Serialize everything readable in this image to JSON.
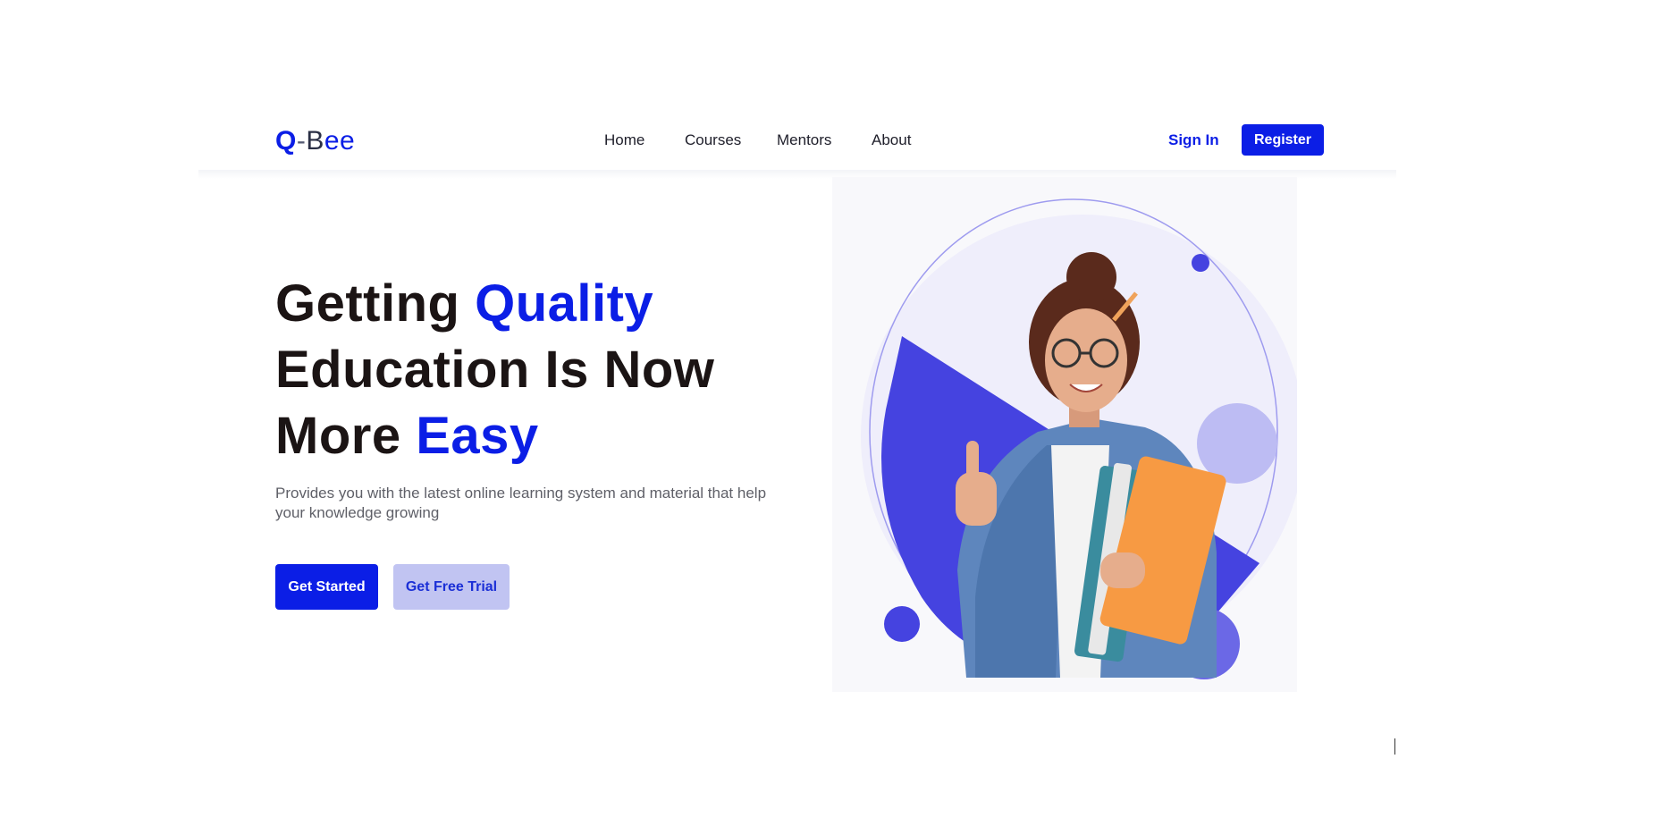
{
  "brand": {
    "logo_q": "Q",
    "logo_dash": "-",
    "logo_b": "B",
    "logo_ee": "ee"
  },
  "nav": {
    "items": [
      {
        "label": "Home"
      },
      {
        "label": "Courses"
      },
      {
        "label": "Mentors"
      },
      {
        "label": "About"
      }
    ],
    "signin_label": "Sign In",
    "register_label": "Register"
  },
  "hero": {
    "title_line1_a": "Getting ",
    "title_line1_b": "Quality",
    "title_line2": "Education Is Now",
    "title_line3_a": "More ",
    "title_line3_b": "Easy",
    "description": "Provides you with the latest online learning system and material that help your knowledge growing",
    "primary_button": "Get Started",
    "secondary_button": "Get Free Trial"
  },
  "colors": {
    "primary": "#0b1ee6",
    "primary_light": "#c1c4f2",
    "heading": "#1b1414",
    "body_text": "#5f6068",
    "illustration_purple": "#4543e0",
    "illustration_lavender": "#bdbcf3"
  },
  "icons": {
    "hero_illustration": "student-with-books-illustration"
  }
}
